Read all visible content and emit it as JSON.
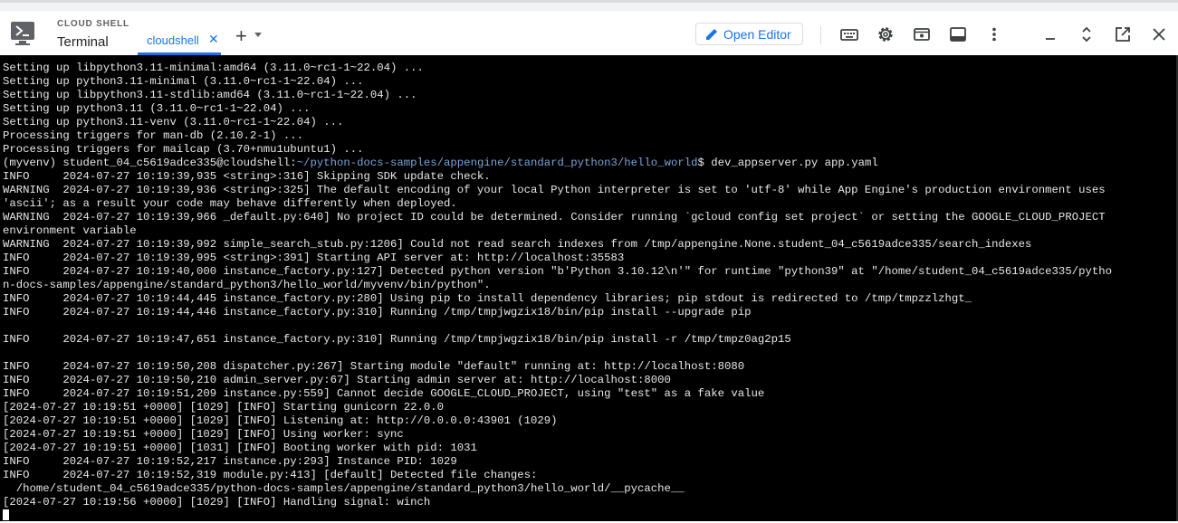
{
  "header": {
    "app_subtitle": "CLOUD SHELL",
    "app_title": "Terminal",
    "tab_label": "cloudshell",
    "open_editor_label": "Open Editor"
  },
  "icons": {
    "app": "terminal-icon",
    "tab_close": "close-icon",
    "add_tab": "plus-icon",
    "open_editor": "pencil-icon",
    "toolbar": [
      "keyboard-icon",
      "gear-icon",
      "web-preview-icon",
      "layout-icon",
      "more-vert-icon",
      "minimize-icon",
      "restore-icon",
      "open-in-new-icon",
      "close-icon"
    ]
  },
  "terminal": {
    "lines": [
      "Setting up libpython3.11-minimal:amd64 (3.11.0~rc1-1~22.04) ...",
      "Setting up python3.11-minimal (3.11.0~rc1-1~22.04) ...",
      "Setting up libpython3.11-stdlib:amd64 (3.11.0~rc1-1~22.04) ...",
      "Setting up python3.11 (3.11.0~rc1-1~22.04) ...",
      "Setting up python3.11-venv (3.11.0~rc1-1~22.04) ...",
      "Processing triggers for man-db (2.10.2-1) ...",
      "Processing triggers for mailcap (3.70+nmu1ubuntu1) ..."
    ],
    "prompt_user": "(myvenv) student_04_c5619adce335@cloudshell:",
    "prompt_path": "~/python-docs-samples/appengine/standard_python3/hello_world",
    "prompt_command": "$ dev_appserver.py app.yaml",
    "output_lines": [
      "INFO     2024-07-27 10:19:39,935 <string>:316] Skipping SDK update check.",
      "WARNING  2024-07-27 10:19:39,936 <string>:325] The default encoding of your local Python interpreter is set to 'utf-8' while App Engine's production environment uses",
      "'ascii'; as a result your code may behave differently when deployed.",
      "WARNING  2024-07-27 10:19:39,966 _default.py:640] No project ID could be determined. Consider running `gcloud config set project` or setting the GOOGLE_CLOUD_PROJECT",
      "environment variable",
      "WARNING  2024-07-27 10:19:39,992 simple_search_stub.py:1206] Could not read search indexes from /tmp/appengine.None.student_04_c5619adce335/search_indexes",
      "INFO     2024-07-27 10:19:39,995 <string>:391] Starting API server at: http://localhost:35583",
      "INFO     2024-07-27 10:19:40,000 instance_factory.py:127] Detected python version \"b'Python 3.10.12\\n'\" for runtime \"python39\" at \"/home/student_04_c5619adce335/pytho",
      "n-docs-samples/appengine/standard_python3/hello_world/myvenv/bin/python\".",
      "INFO     2024-07-27 10:19:44,445 instance_factory.py:280] Using pip to install dependency libraries; pip stdout is redirected to /tmp/tmpzzlzhgt_",
      "INFO     2024-07-27 10:19:44,446 instance_factory.py:310] Running /tmp/tmpjwgzix18/bin/pip install --upgrade pip",
      "",
      "INFO     2024-07-27 10:19:47,651 instance_factory.py:310] Running /tmp/tmpjwgzix18/bin/pip install -r /tmp/tmpz0ag2p15",
      "",
      "INFO     2024-07-27 10:19:50,208 dispatcher.py:267] Starting module \"default\" running at: http://localhost:8080",
      "INFO     2024-07-27 10:19:50,210 admin_server.py:67] Starting admin server at: http://localhost:8000",
      "INFO     2024-07-27 10:19:51,209 instance.py:559] Cannot decide GOOGLE_CLOUD_PROJECT, using \"test\" as a fake value",
      "[2024-07-27 10:19:51 +0000] [1029] [INFO] Starting gunicorn 22.0.0",
      "[2024-07-27 10:19:51 +0000] [1029] [INFO] Listening at: http://0.0.0.0:43901 (1029)",
      "[2024-07-27 10:19:51 +0000] [1029] [INFO] Using worker: sync",
      "[2024-07-27 10:19:51 +0000] [1031] [INFO] Booting worker with pid: 1031",
      "INFO     2024-07-27 10:19:52,217 instance.py:293] Instance PID: 1029",
      "INFO     2024-07-27 10:19:52,319 module.py:413] [default] Detected file changes:",
      "  /home/student_04_c5619adce335/python-docs-samples/appengine/standard_python3/hello_world/__pycache__",
      "[2024-07-27 10:19:56 +0000] [1029] [INFO] Handling signal: winch"
    ]
  }
}
